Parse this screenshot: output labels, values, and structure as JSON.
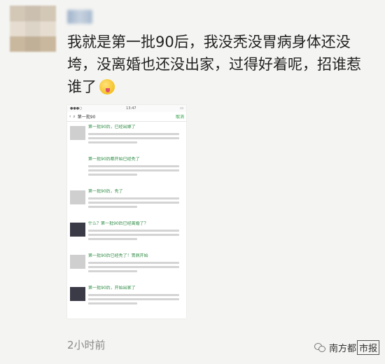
{
  "post": {
    "text": "我就是第一批90后，我没秃没胃病身体还没垮，没离婚也还没出家，过得好着呢，招谁惹谁了",
    "emoji": "grinning-tongue-emoji",
    "time": "2小时前"
  },
  "screenshot": {
    "status_time": "13:47",
    "header_title": "第一批90",
    "close_label": "取消",
    "articles": [
      {
        "title": "第一批90后，已经出嫁了",
        "thumb": "light"
      },
      {
        "title": "第一批90后都开始已经秃了",
        "thumb": "none"
      },
      {
        "title": "第一批90后，秃了",
        "thumb": "light"
      },
      {
        "title": "什么？第一批90后已经离婚了？",
        "thumb": "dark"
      },
      {
        "title": "第一批90后已经秃了！胃病开始",
        "thumb": "light"
      },
      {
        "title": "第一批90后，开始出家了",
        "thumb": "dark"
      }
    ]
  },
  "watermark": {
    "prefix": "南方都",
    "boxed": "市报"
  }
}
